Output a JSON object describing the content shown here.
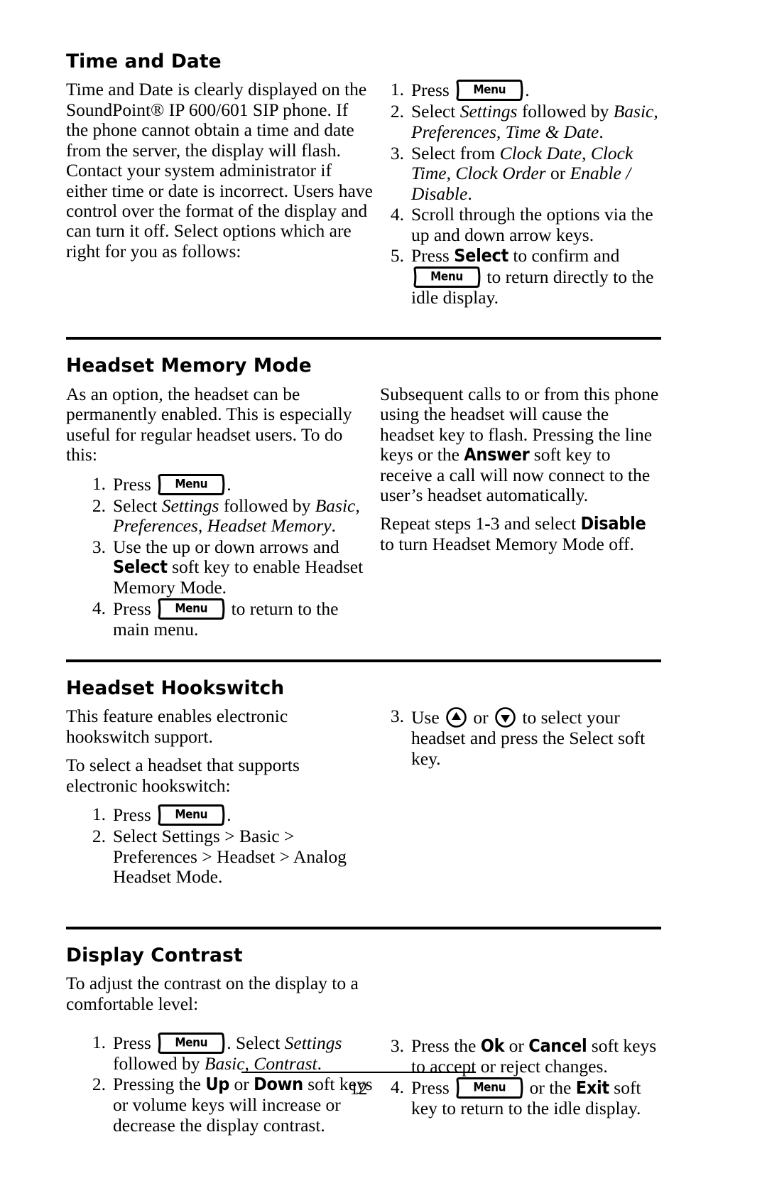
{
  "document": {
    "page_number": "12"
  },
  "keys": {
    "menu_label": "Menu",
    "up_arrow_icon": "up-arrow-key",
    "down_arrow_icon": "down-arrow-key"
  },
  "sections": [
    {
      "id": "time-and-date",
      "title": "Time and Date",
      "left": {
        "paragraph": "Time and Date is clearly displayed on the SoundPoint® IP 600/601 SIP phone.  If the phone cannot obtain a time and date from the server, the display will flash.  Contact your system administrator if either time or date is incorrect.  Users have control over the format of the display and can turn it off.  Select options which are right for you as follows:"
      },
      "right": {
        "steps": [
          {
            "num": "1.",
            "parts": [
              {
                "t": "text",
                "v": "Press "
              },
              {
                "t": "menukey"
              },
              {
                "t": "text",
                "v": "."
              }
            ]
          },
          {
            "num": "2.",
            "parts": [
              {
                "t": "text",
                "v": "Select "
              },
              {
                "t": "italic",
                "v": "Settings"
              },
              {
                "t": "text",
                "v": " followed by "
              },
              {
                "t": "italic",
                "v": "Basic, Preferences, Time & Date"
              },
              {
                "t": "text",
                "v": "."
              }
            ]
          },
          {
            "num": "3.",
            "parts": [
              {
                "t": "text",
                "v": "Select from "
              },
              {
                "t": "italic",
                "v": "Clock Date"
              },
              {
                "t": "text",
                "v": ", "
              },
              {
                "t": "italic",
                "v": "Clock Time"
              },
              {
                "t": "text",
                "v": ", "
              },
              {
                "t": "italic",
                "v": "Clock Order"
              },
              {
                "t": "text",
                "v": " or "
              },
              {
                "t": "italic",
                "v": "Enable / Disable"
              },
              {
                "t": "text",
                "v": "."
              }
            ]
          },
          {
            "num": "4.",
            "parts": [
              {
                "t": "text",
                "v": "Scroll through the options via the up and down arrow keys."
              }
            ]
          },
          {
            "num": "5.",
            "parts": [
              {
                "t": "text",
                "v": "Press "
              },
              {
                "t": "softkey",
                "v": "Select"
              },
              {
                "t": "text",
                "v": " to confirm and "
              },
              {
                "t": "menukey"
              },
              {
                "t": "text",
                "v": " to return directly to the idle display."
              }
            ]
          }
        ]
      }
    },
    {
      "id": "headset-memory-mode",
      "title": "Headset Memory Mode",
      "left": {
        "paragraph": "As an option, the headset can be permanently enabled.  This is especially useful for regular headset users.  To do this:",
        "steps": [
          {
            "num": "1.",
            "parts": [
              {
                "t": "text",
                "v": "Press "
              },
              {
                "t": "menukey"
              },
              {
                "t": "text",
                "v": "."
              }
            ]
          },
          {
            "num": "2.",
            "parts": [
              {
                "t": "text",
                "v": "Select "
              },
              {
                "t": "italic",
                "v": "Settings"
              },
              {
                "t": "text",
                "v": " followed by "
              },
              {
                "t": "italic",
                "v": "Basic, Preferences, Headset Memory"
              },
              {
                "t": "text",
                "v": "."
              }
            ]
          },
          {
            "num": "3.",
            "parts": [
              {
                "t": "text",
                "v": "Use the up or down arrows and "
              },
              {
                "t": "softkey",
                "v": "Select"
              },
              {
                "t": "text",
                "v": " soft key to enable Headset Memory Mode."
              }
            ]
          },
          {
            "num": "4.",
            "parts": [
              {
                "t": "text",
                "v": "Press "
              },
              {
                "t": "menukey"
              },
              {
                "t": "text",
                "v": " to return to the main menu."
              }
            ]
          }
        ]
      },
      "right": {
        "paragraph_1_parts": [
          {
            "t": "text",
            "v": "Subsequent calls to or from this phone using the headset will cause the headset key to flash.  Pressing the line keys or the "
          },
          {
            "t": "softkey",
            "v": "Answer"
          },
          {
            "t": "text",
            "v": " soft key to receive a call will now connect to the user’s headset automatically."
          }
        ],
        "paragraph_2_parts": [
          {
            "t": "text",
            "v": "Repeat steps 1-3 and select "
          },
          {
            "t": "softkey",
            "v": "Disable"
          },
          {
            "t": "text",
            "v": " to turn Headset Memory Mode off."
          }
        ]
      }
    },
    {
      "id": "headset-hookswitch",
      "title": "Headset Hookswitch",
      "left": {
        "paragraph_1": "This feature enables electronic hookswitch support.",
        "paragraph_2": "To select a headset that supports electronic hookswitch:",
        "steps": [
          {
            "num": "1.",
            "parts": [
              {
                "t": "text",
                "v": "Press "
              },
              {
                "t": "menukey"
              },
              {
                "t": "text",
                "v": "."
              }
            ]
          },
          {
            "num": "2.",
            "parts": [
              {
                "t": "text",
                "v": "Select Settings > Basic > Preferences > Headset > Analog Headset Mode."
              }
            ]
          }
        ]
      },
      "right": {
        "steps": [
          {
            "num": "3.",
            "parts": [
              {
                "t": "text",
                "v": "Use "
              },
              {
                "t": "uparrow"
              },
              {
                "t": "text",
                "v": " or "
              },
              {
                "t": "downarrow"
              },
              {
                "t": "text",
                "v": " to select your headset and press the Select soft key."
              }
            ]
          }
        ]
      }
    },
    {
      "id": "display-contrast",
      "title": "Display Contrast",
      "left": {
        "paragraph": "To adjust the contrast on the display to a comfortable level:",
        "steps": [
          {
            "num": "1.",
            "parts": [
              {
                "t": "text",
                "v": "Press "
              },
              {
                "t": "menukey"
              },
              {
                "t": "text",
                "v": ".  Select "
              },
              {
                "t": "italic",
                "v": "Settings"
              },
              {
                "t": "text",
                "v": " followed by "
              },
              {
                "t": "italic",
                "v": "Basic, Contrast"
              },
              {
                "t": "text",
                "v": "."
              }
            ]
          },
          {
            "num": "2.",
            "parts": [
              {
                "t": "text",
                "v": "Pressing the "
              },
              {
                "t": "softkey",
                "v": "Up"
              },
              {
                "t": "text",
                "v": " or "
              },
              {
                "t": "softkey",
                "v": "Down"
              },
              {
                "t": "text",
                "v": " soft keys or volume keys will increase or decrease the display contrast."
              }
            ]
          }
        ]
      },
      "right": {
        "steps": [
          {
            "num": "3.",
            "parts": [
              {
                "t": "text",
                "v": "Press the "
              },
              {
                "t": "softkey",
                "v": "Ok"
              },
              {
                "t": "text",
                "v": " or "
              },
              {
                "t": "softkey",
                "v": "Cancel"
              },
              {
                "t": "text",
                "v": " soft keys to accept or reject changes."
              }
            ]
          },
          {
            "num": "4.",
            "parts": [
              {
                "t": "text",
                "v": "Press "
              },
              {
                "t": "menukey"
              },
              {
                "t": "text",
                "v": " or the "
              },
              {
                "t": "softkey",
                "v": "Exit"
              },
              {
                "t": "text",
                "v": " soft key to return to the idle display."
              }
            ]
          }
        ]
      }
    }
  ]
}
